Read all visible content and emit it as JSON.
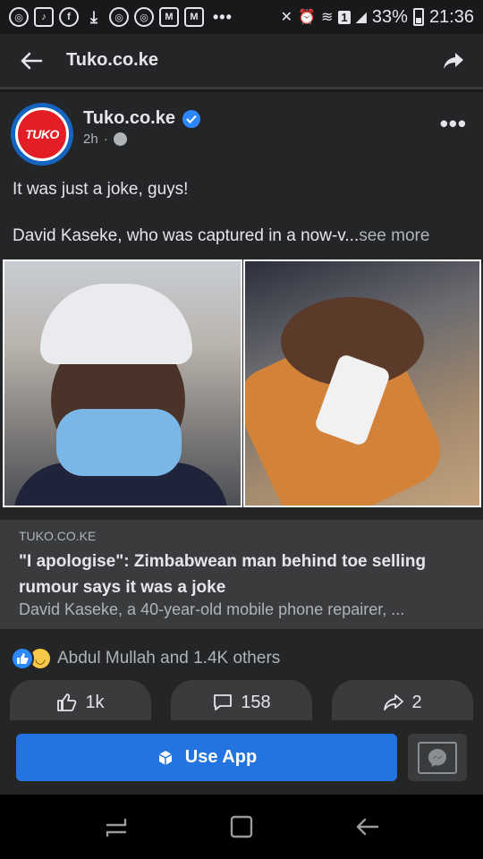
{
  "status_bar": {
    "battery": "33%",
    "time": "21:36",
    "signal_badge": "1",
    "overflow": "•••",
    "left_icons": [
      "chrome-icon",
      "tiktok-icon",
      "facebook-icon",
      "download-icon",
      "chrome-icon",
      "chrome-icon",
      "gmail-icon",
      "gmail-icon"
    ]
  },
  "header": {
    "title": "Tuko.co.ke"
  },
  "post": {
    "author": "Tuko.co.ke",
    "avatar_text": "TUKO",
    "time_ago": "2h",
    "separator": "·",
    "text_line1": "It was just a joke, guys!",
    "text_line2": "David Kaseke, who was captured in a now-v...",
    "see_more": "see more",
    "link": {
      "domain": "TUKO.CO.KE",
      "title": "\"I apologise\": Zimbabwean man behind toe selling rumour says it was a joke",
      "description": "David Kaseke, a 40-year-old mobile phone repairer, ..."
    },
    "reactions_text": "Abdul Mullah and 1.4K others",
    "actions": {
      "like_count": "1k",
      "comment_count": "158",
      "share_count": "2"
    }
  },
  "bottom": {
    "use_app_label": "Use App"
  },
  "colors": {
    "background": "#18191a",
    "card": "#242526",
    "accent": "#2374e1",
    "brand_red": "#e41e26"
  }
}
